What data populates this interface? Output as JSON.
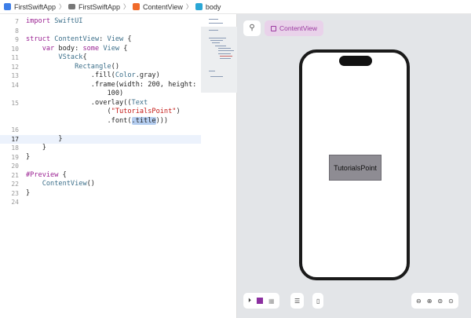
{
  "breadcrumb": [
    {
      "label": "FirstSwiftApp",
      "icon": "app-icon"
    },
    {
      "label": "FirstSwiftApp",
      "icon": "folder-icon"
    },
    {
      "label": "ContentView",
      "icon": "swift-file-icon"
    },
    {
      "label": "body",
      "icon": "property-icon"
    }
  ],
  "editor": {
    "current_line": "17",
    "lines": [
      {
        "n": "7",
        "code": "import SwiftUI"
      },
      {
        "n": "8",
        "code": ""
      },
      {
        "n": "9",
        "code": "struct ContentView: View {"
      },
      {
        "n": "10",
        "code": "    var body: some View {"
      },
      {
        "n": "11",
        "code": "        VStack{"
      },
      {
        "n": "12",
        "code": "            Rectangle()"
      },
      {
        "n": "13",
        "code": "                .fill(Color.gray)"
      },
      {
        "n": "14",
        "code": "                .frame(width: 200, height:"
      },
      {
        "n": "",
        "code": "                    100)"
      },
      {
        "n": "15",
        "code": "                .overlay((Text"
      },
      {
        "n": "",
        "code": "                    (\"TutorialsPoint\")"
      },
      {
        "n": "",
        "code": "                    .font(.title)))"
      },
      {
        "n": "16",
        "code": ""
      },
      {
        "n": "17",
        "code": "        }"
      },
      {
        "n": "18",
        "code": "    }"
      },
      {
        "n": "19",
        "code": "}"
      },
      {
        "n": "20",
        "code": ""
      },
      {
        "n": "21",
        "code": "#Preview {"
      },
      {
        "n": "22",
        "code": "    ContentView()"
      },
      {
        "n": "23",
        "code": "}"
      },
      {
        "n": "24",
        "code": ""
      }
    ]
  },
  "preview": {
    "selector_label": "ContentView",
    "rect_text": "TutorialsPoint",
    "rect_color": "#8e8c93"
  }
}
